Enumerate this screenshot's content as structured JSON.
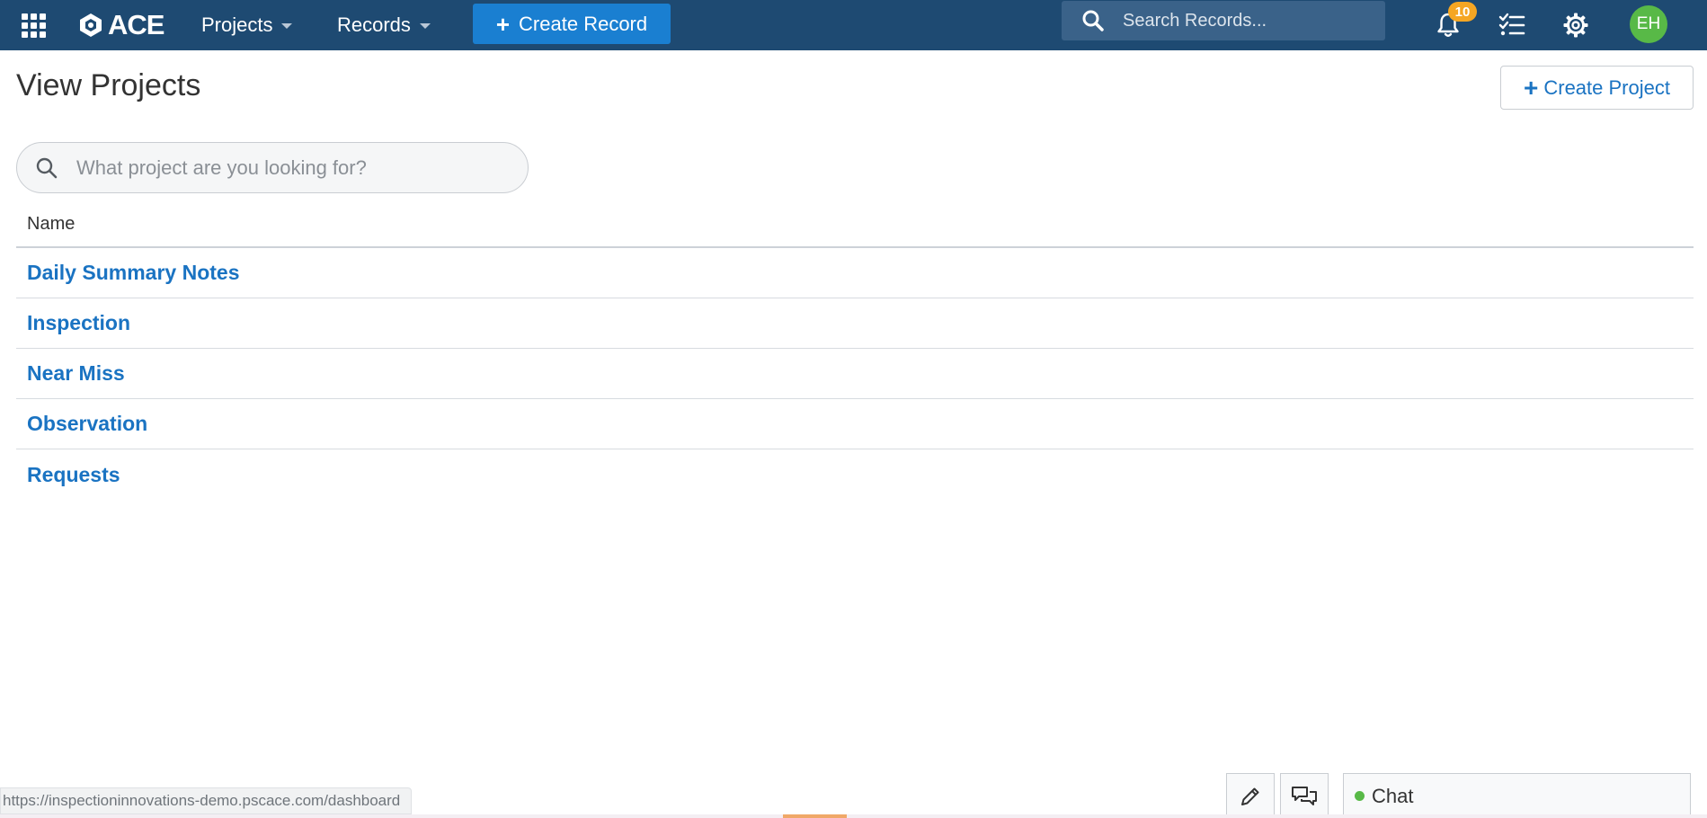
{
  "topbar": {
    "logo_text": "ACE",
    "nav": [
      {
        "label": "Projects"
      },
      {
        "label": "Records"
      }
    ],
    "create_record_label": "Create Record",
    "search_placeholder": "Search Records...",
    "notification_count": "10",
    "avatar_initials": "EH",
    "colors": {
      "bar": "#1e4a72",
      "accent": "#1a7fd1",
      "badge": "#f5a623",
      "avatar": "#58b947"
    },
    "icons": [
      "apps-grid-icon",
      "bell-icon",
      "task-list-icon",
      "gear-icon",
      "search-icon"
    ]
  },
  "page": {
    "title": "View Projects",
    "create_project_label": "Create Project",
    "search_placeholder": "What project are you looking for?"
  },
  "table": {
    "column_header": "Name",
    "rows": [
      {
        "name": "Daily Summary Notes"
      },
      {
        "name": "Inspection"
      },
      {
        "name": "Near Miss"
      },
      {
        "name": "Observation"
      },
      {
        "name": "Requests"
      }
    ],
    "link_color": "#1a73c2"
  },
  "footer": {
    "status_url": "https://inspectioninnovations-demo.pscace.com/dashboard",
    "chat_label": "Chat",
    "icons": [
      "pencil-icon",
      "chat-bubbles-icon"
    ]
  }
}
